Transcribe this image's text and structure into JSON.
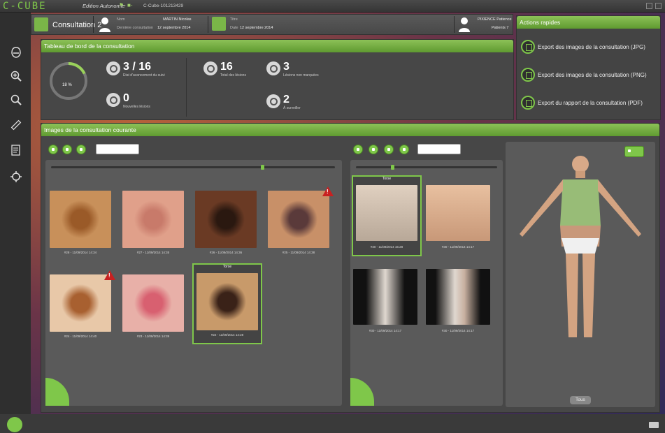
{
  "titlebar": {
    "logo": "C-CUBE",
    "edition": "Edition Autonomie",
    "badges": "⚑- ■-",
    "build": "C-Cube-101213429"
  },
  "header": {
    "consultation": "Consultation 2",
    "nom_label": "Nom",
    "nom_value": "MARTIN Nicolas",
    "derniere_label": "Dernière consultation",
    "derniere_value": "12 septembre 2014",
    "titre_label": "Titre",
    "date_label": "Date",
    "date_value": "12 septembre 2014",
    "praticien": "PIXIENCE Patience",
    "patients": "Patients 7"
  },
  "quick_actions": {
    "title": "Actions rapides",
    "items": [
      "Export des images de la consultation (JPG)",
      "Export des images de la consultation (PNG)",
      "Export du rapport de la consultation (PDF)"
    ]
  },
  "dashboard": {
    "title": "Tableau de bord de la consultation",
    "progress_label": "18 %",
    "progress": 0.18,
    "suivi_value": "3 / 16",
    "suivi_label": "Etat d'avancement du suivi",
    "nouvelles_value": "0",
    "nouvelles_label": "Nouvelles lésions",
    "total_value": "16",
    "total_label": "Total des lésions",
    "non_marquees_value": "3",
    "non_marquees_label": "Lésions non marquées",
    "surveiller_value": "2",
    "surveiller_label": "À surveiller"
  },
  "images": {
    "title": "Images de la consultation courante",
    "lesions": [
      {
        "caption": "#28 - 11/09/2014 14:34",
        "color": "#c8905a",
        "spot": "#9a5a28",
        "warn": false
      },
      {
        "caption": "#27 - 11/09/2014 14:35",
        "color": "#e0a08a",
        "spot": "#c87a6a",
        "warn": false
      },
      {
        "caption": "#26 - 11/09/2014 14:36",
        "color": "#6a3a24",
        "spot": "#2a1810",
        "warn": false
      },
      {
        "caption": "#25 - 11/09/2014 14:38",
        "color": "#c89068",
        "spot": "#5a3a3a",
        "warn": true
      },
      {
        "caption": "#24 - 11/09/2014 14:40",
        "color": "#e8c8a8",
        "spot": "#a86030",
        "warn": true
      },
      {
        "caption": "#23 - 11/09/2014 14:39",
        "color": "#e8b0a8",
        "spot": "#d86070",
        "warn": false
      },
      {
        "caption": "#22 - 11/09/2014 14:28",
        "color": "#c89a6a",
        "spot": "#3a2218",
        "warn": false,
        "selected": true,
        "head": "Torse"
      }
    ],
    "overview": [
      {
        "caption": "#30 - 11/09/2014 15:28",
        "head": "Torse",
        "selected": true
      },
      {
        "caption": "#30 - 11/09/2014 14:17"
      },
      {
        "caption": "#30 - 11/09/2014 14:17"
      },
      {
        "caption": "#30 - 11/09/2014 14:17"
      }
    ],
    "tous_button": "Tous"
  }
}
